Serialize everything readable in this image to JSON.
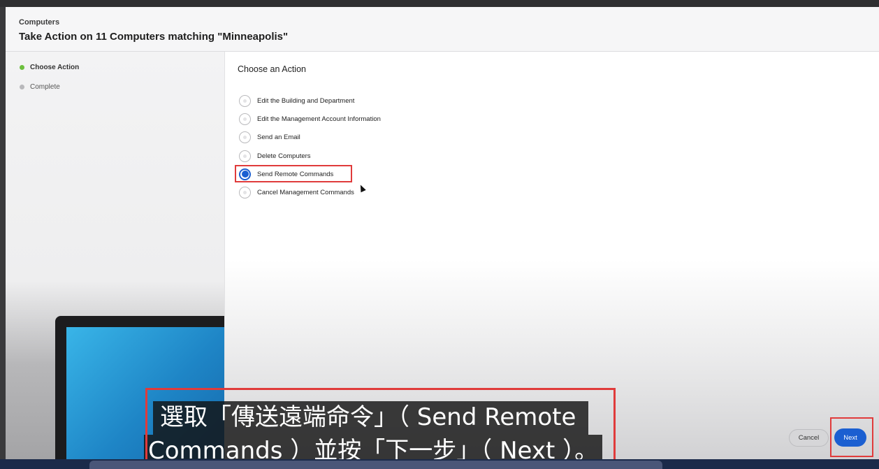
{
  "header": {
    "breadcrumb": "Computers",
    "title": "Take Action on 11 Computers matching \"Minneapolis\""
  },
  "steps": [
    {
      "label": "Choose Action",
      "status": "active",
      "color": "#6cbf3d"
    },
    {
      "label": "Complete",
      "status": "pending",
      "color": "#b8b8bb"
    }
  ],
  "main": {
    "heading": "Choose an Action",
    "options": [
      {
        "label": "Edit the Building and Department",
        "selected": false
      },
      {
        "label": "Edit the Management Account Information",
        "selected": false
      },
      {
        "label": "Send an Email",
        "selected": false
      },
      {
        "label": "Delete Computers",
        "selected": false
      },
      {
        "label": "Send Remote Commands",
        "selected": true
      },
      {
        "label": "Cancel Management Commands",
        "selected": false
      }
    ]
  },
  "buttons": {
    "cancel": "Cancel",
    "next": "Next"
  },
  "caption": {
    "line1": "選取「傳送遠端命令」（ Send Remote",
    "line2": "Commands ）並按「下一步」（ Next ）。"
  },
  "colors": {
    "accent": "#1b5fd1",
    "active_step": "#6cbf3d",
    "highlight": "#e03b3b"
  }
}
